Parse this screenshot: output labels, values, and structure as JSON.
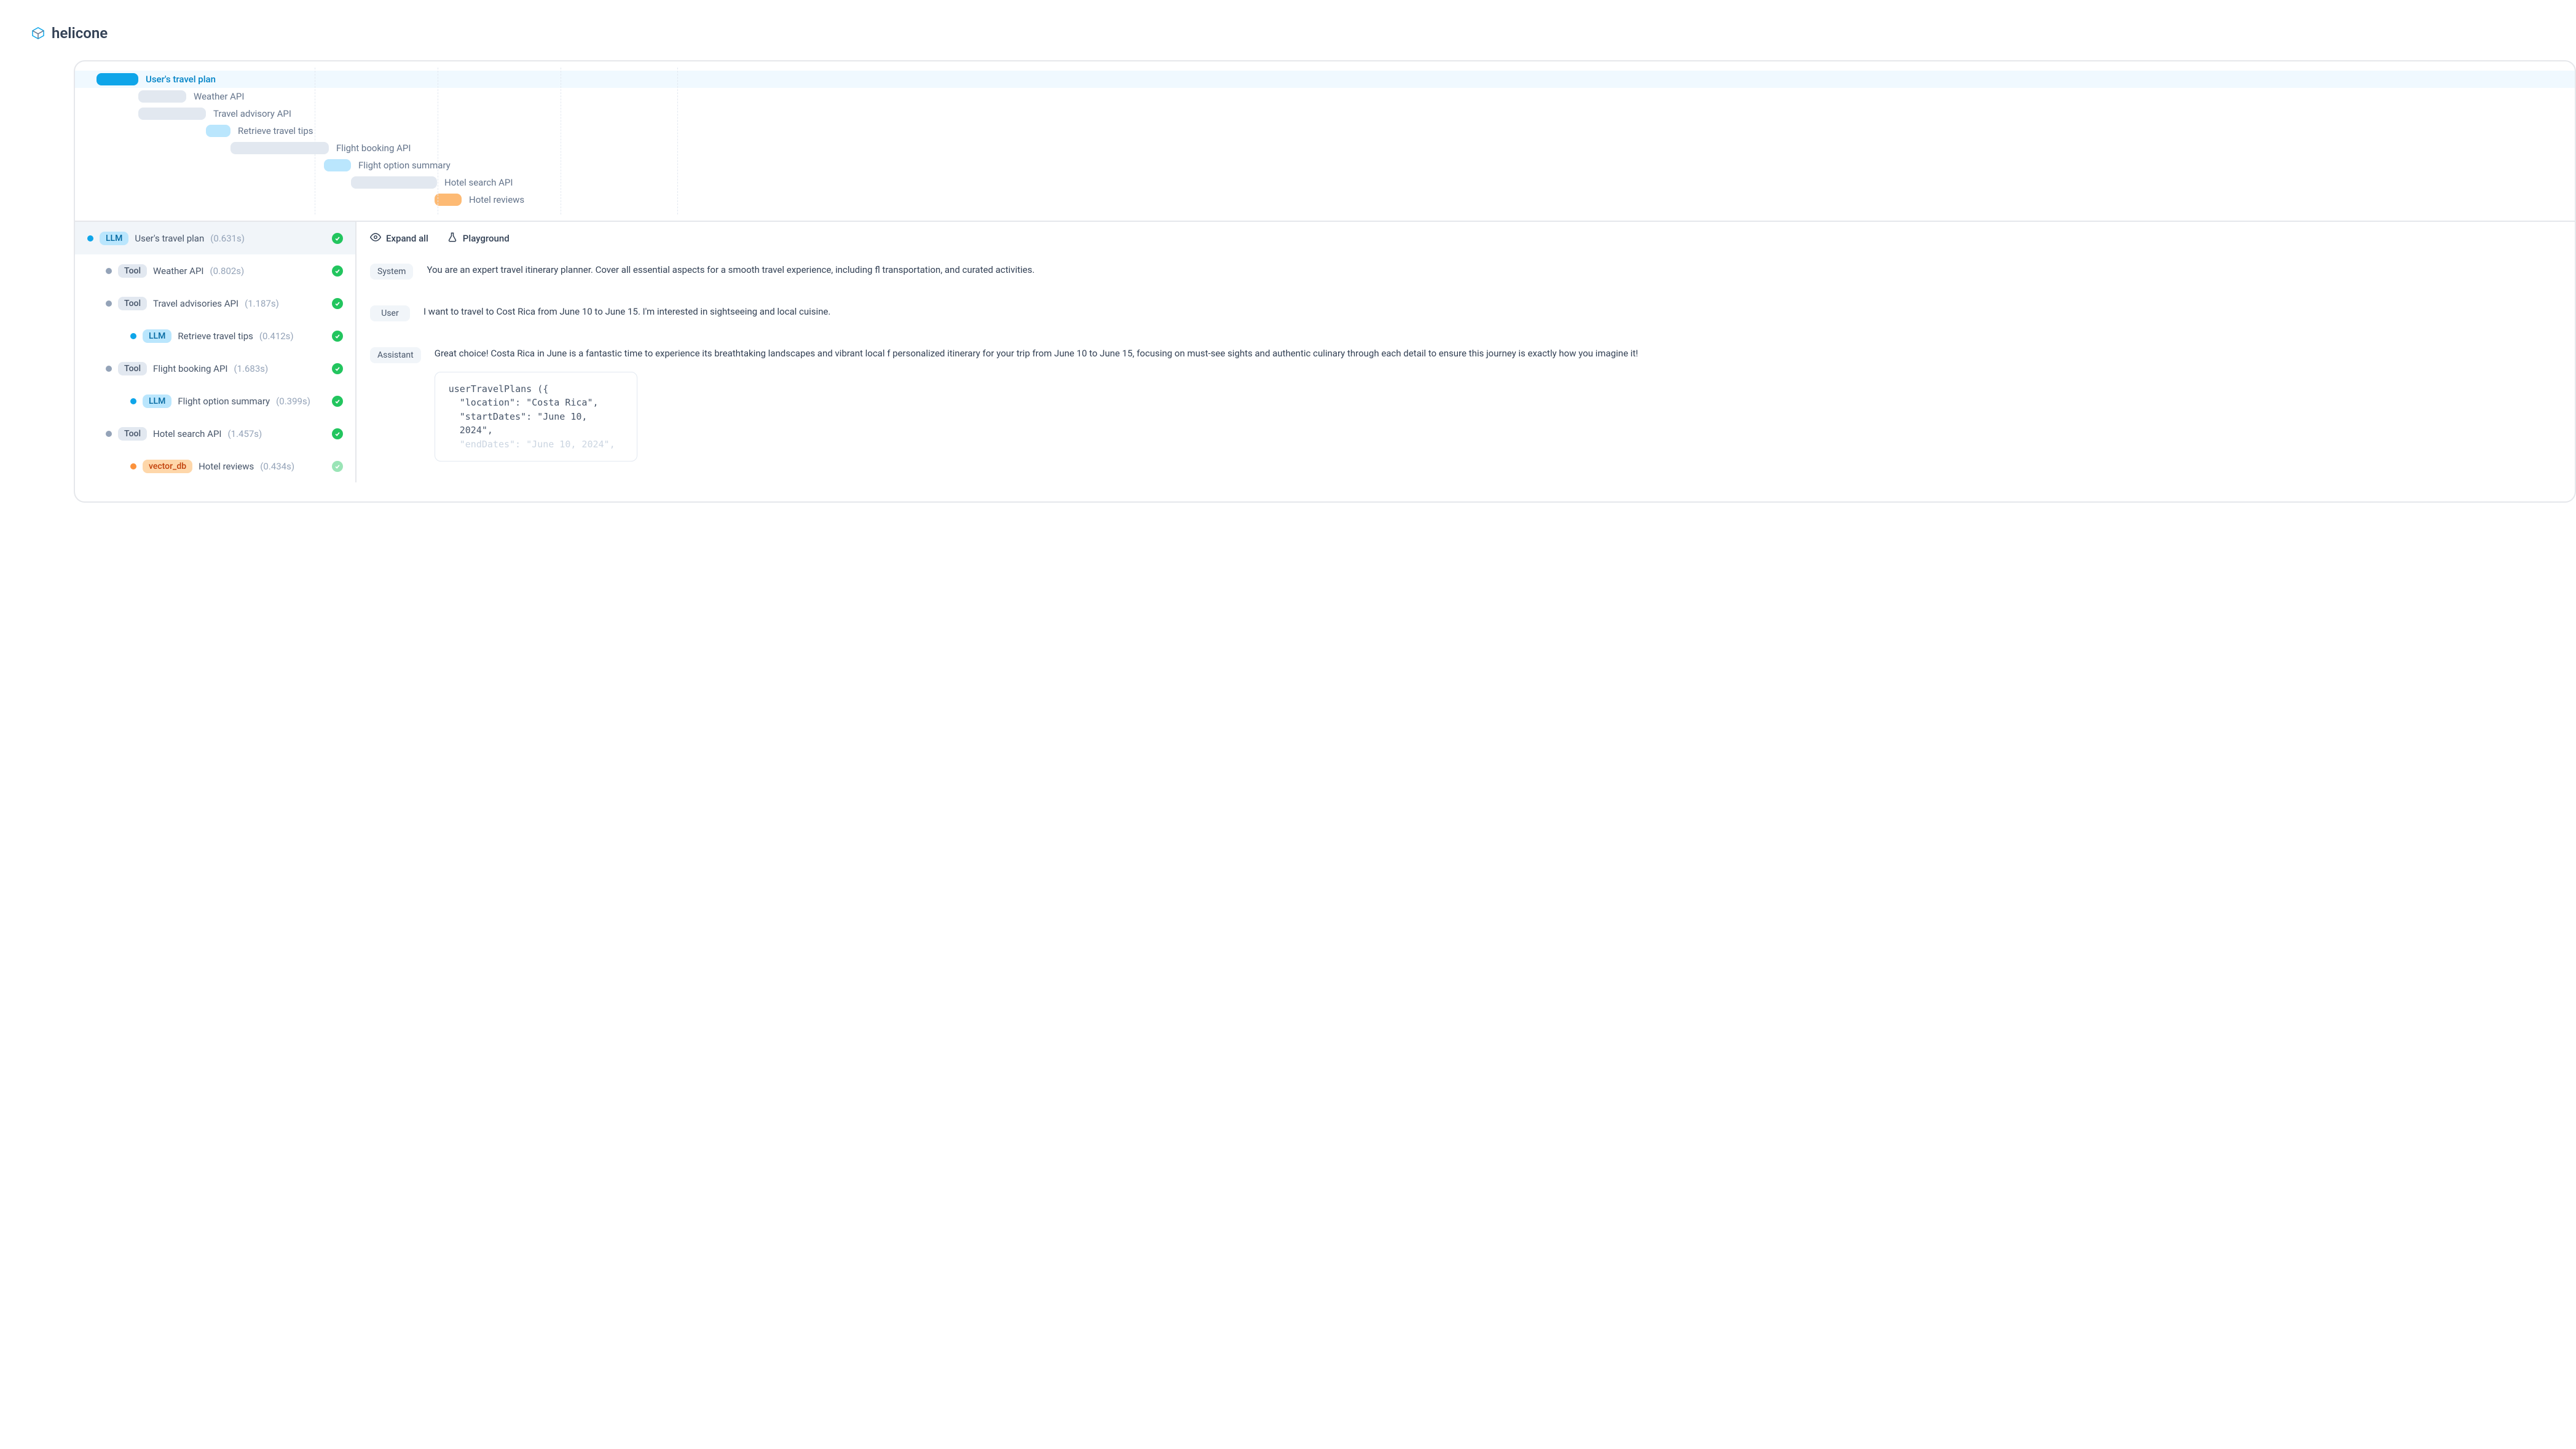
{
  "brand": "helicone",
  "timeline": [
    {
      "label": "User's travel plan",
      "active": true,
      "color": "blue",
      "offset": 0,
      "width": 68
    },
    {
      "label": "Weather API",
      "color": "gray",
      "offset": 68,
      "width": 78
    },
    {
      "label": "Travel advisory API",
      "color": "gray",
      "offset": 68,
      "width": 110
    },
    {
      "label": "Retrieve travel tips",
      "color": "lightblue",
      "offset": 178,
      "width": 40
    },
    {
      "label": "Flight booking API",
      "color": "gray",
      "offset": 218,
      "width": 160
    },
    {
      "label": "Flight option summary",
      "color": "lightblue",
      "offset": 370,
      "width": 44
    },
    {
      "label": "Hotel search API",
      "color": "gray",
      "offset": 414,
      "width": 140
    },
    {
      "label": "Hotel reviews",
      "color": "orange",
      "offset": 550,
      "width": 44
    }
  ],
  "gridlines": [
    390,
    590,
    790,
    980
  ],
  "tree": [
    {
      "type": "LLM",
      "dot": "blue",
      "name": "User's travel plan",
      "time": "(0.631s)",
      "indent": 0,
      "selected": true
    },
    {
      "type": "Tool",
      "dot": "gray",
      "name": "Weather API",
      "time": "(0.802s)",
      "indent": 1
    },
    {
      "type": "Tool",
      "dot": "gray",
      "name": "Travel advisories API",
      "time": "(1.187s)",
      "indent": 1
    },
    {
      "type": "LLM",
      "dot": "blue",
      "name": "Retrieve travel tips",
      "time": "(0.412s)",
      "indent": 2
    },
    {
      "type": "Tool",
      "dot": "gray",
      "name": "Flight booking API",
      "time": "(1.683s)",
      "indent": 1
    },
    {
      "type": "LLM",
      "dot": "blue",
      "name": "Flight option summary",
      "time": "(0.399s)",
      "indent": 2
    },
    {
      "type": "Tool",
      "dot": "gray",
      "name": "Hotel search API",
      "time": "(1.457s)",
      "indent": 1
    },
    {
      "type": "vector_db",
      "dot": "orange",
      "name": "Hotel reviews",
      "time": "(0.434s)",
      "indent": 2,
      "faded": true
    }
  ],
  "toolbar": {
    "expand": "Expand all",
    "playground": "Playground"
  },
  "messages": {
    "system": {
      "role": "System",
      "text": "You are an expert travel itinerary planner. Cover all essential aspects for a smooth travel experience, including fl transportation, and curated activities."
    },
    "user": {
      "role": "User",
      "text": "I want to travel to Cost Rica from June 10 to June 15. I'm interested in sightseeing and local cuisine."
    },
    "assistant": {
      "role": "Assistant",
      "text": "Great choice! Costa Rica in June is a fantastic time to experience its breathtaking landscapes and vibrant local f personalized itinerary for your trip from June 10 to June 15, focusing on must-see sights and authentic culinary through each detail to ensure this journey is exactly how you imagine it!"
    }
  },
  "code": {
    "line1": "userTravelPlans ({",
    "line2": "\"location\": \"Costa Rica\",",
    "line3": "\"startDates\": \"June 10, 2024\",",
    "line4": "\"endDates\": \"June 10, 2024\","
  }
}
